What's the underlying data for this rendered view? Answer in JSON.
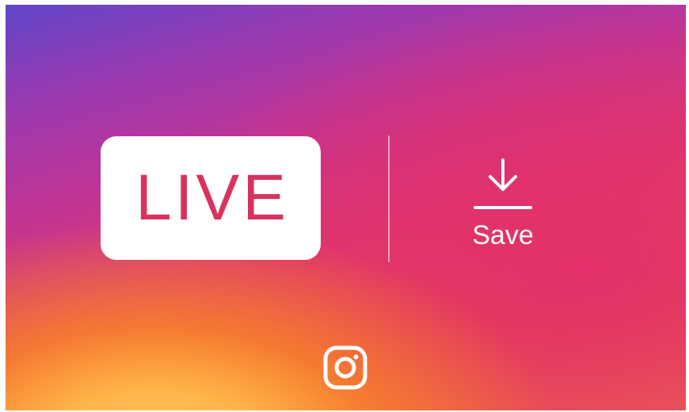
{
  "live_badge": {
    "label": "LIVE",
    "text_color": "#d7335f",
    "background": "#ffffff"
  },
  "save": {
    "label": "Save",
    "icon": "download-icon"
  },
  "footer": {
    "logo_icon": "instagram-icon"
  },
  "colors": {
    "gradient_purple": "#6046c9",
    "gradient_magenta": "#c03494",
    "gradient_pink": "#dc3870",
    "gradient_orange": "#f5843a",
    "gradient_yellow": "#ffd36a"
  }
}
